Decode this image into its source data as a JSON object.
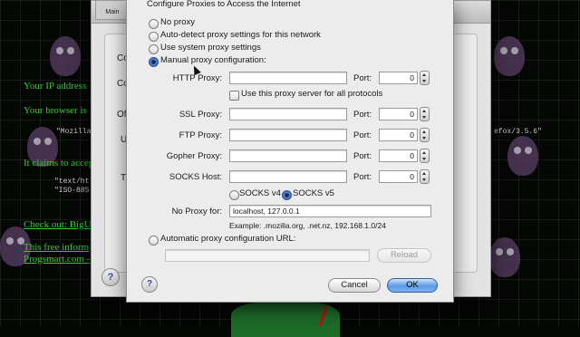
{
  "prefs_window": {
    "main_tab_label": "Main",
    "peek_labels": [
      "Co",
      "Co",
      "Of",
      "U",
      "T"
    ]
  },
  "background_page": {
    "lines": [
      "Your IP address",
      "Your browser is",
      "\"Mozilla",
      "efox/3.5.6\"",
      "It claims to accep",
      "\"text/ht",
      "\"ISO-885",
      "Check out: BigU",
      "This free inform",
      "Progsmart.com -"
    ]
  },
  "dialog": {
    "title": "Configure Proxies to Access the Internet",
    "proxy_modes": [
      {
        "label": "No proxy",
        "checked": false
      },
      {
        "label": "Auto-detect proxy settings for this network",
        "checked": false
      },
      {
        "label": "Use system proxy settings",
        "checked": false
      },
      {
        "label": "Manual proxy configuration:",
        "checked": true
      }
    ],
    "port_label": "Port:",
    "rows": [
      {
        "label": "HTTP Proxy:",
        "host": "",
        "port": "0"
      },
      {
        "label": "SSL Proxy:",
        "host": "",
        "port": "0"
      },
      {
        "label": "FTP Proxy:",
        "host": "",
        "port": "0"
      },
      {
        "label": "Gopher Proxy:",
        "host": "",
        "port": "0"
      },
      {
        "label": "SOCKS Host:",
        "host": "",
        "port": "0"
      }
    ],
    "use_for_all_label": "Use this proxy server for all protocols",
    "socks_v4_label": "SOCKS v4",
    "socks_v5_label": "SOCKS v5",
    "socks_version": "v5",
    "no_proxy_label": "No Proxy for:",
    "no_proxy_value": "localhost, 127.0.0.1",
    "example_text": "Example: .mozilla.org, .net.nz, 192.168.1.0/24",
    "auto_config_label": "Automatic proxy configuration URL:",
    "auto_config_url": "",
    "reload_label": "Reload",
    "cancel_label": "Cancel",
    "ok_label": "OK",
    "help_glyph": "?"
  }
}
